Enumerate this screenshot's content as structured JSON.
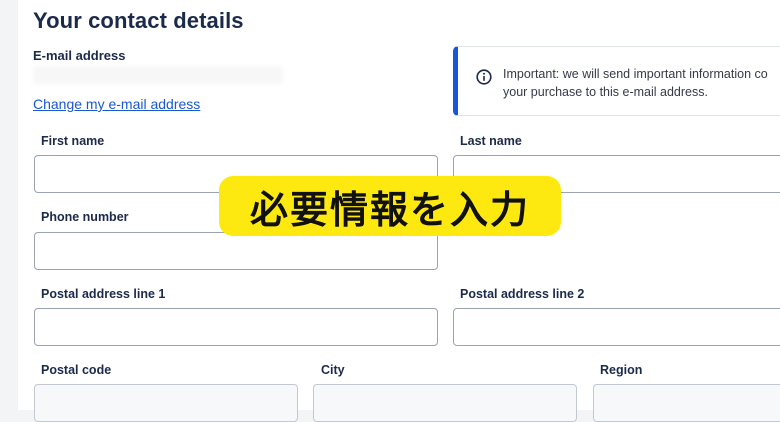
{
  "section": {
    "title": "Your contact details"
  },
  "email": {
    "label": "E-mail address",
    "change_link": "Change my e-mail address"
  },
  "info": {
    "icon": "info-icon",
    "accent_color": "#1a56d6",
    "text_line1": "Important: we will send important information co",
    "text_line2": "your purchase to this e-mail address."
  },
  "fields": {
    "first_name": {
      "label": "First name",
      "value": ""
    },
    "last_name": {
      "label": "Last name",
      "value": ""
    },
    "phone": {
      "label": "Phone number",
      "value": ""
    },
    "address1": {
      "label": "Postal address line 1",
      "value": ""
    },
    "address2": {
      "label": "Postal address line 2",
      "value": ""
    },
    "postal_code": {
      "label": "Postal code",
      "value": ""
    },
    "city": {
      "label": "City",
      "value": ""
    },
    "region": {
      "label": "Region",
      "value": ""
    }
  },
  "overlay": {
    "text": "必要情報を入力",
    "background": "#fde910"
  }
}
